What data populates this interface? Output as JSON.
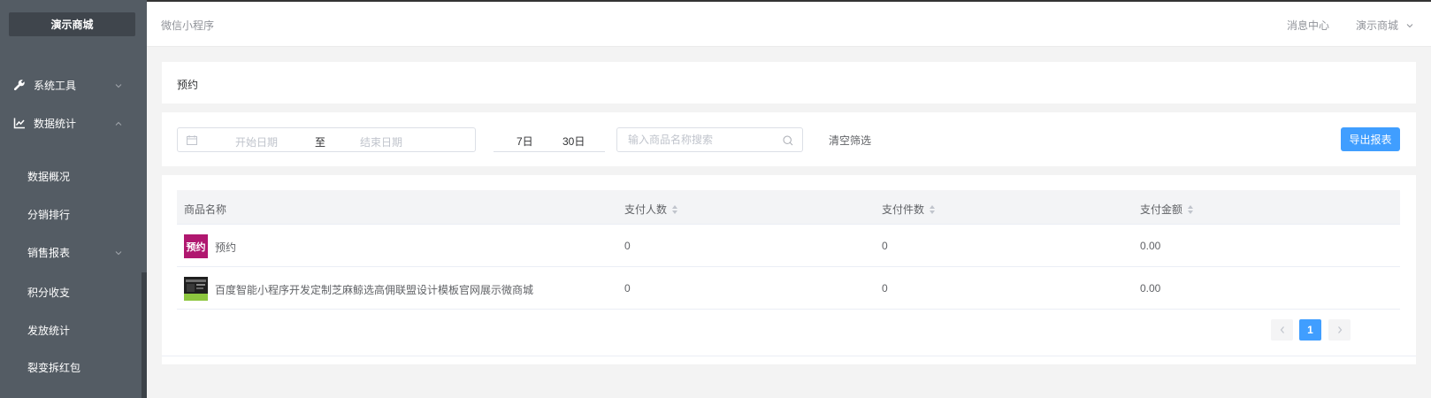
{
  "sidebar": {
    "brand": "演示商城",
    "items": [
      {
        "label": "系统工具",
        "icon": "wrench-icon"
      },
      {
        "label": "数据统计",
        "icon": "line-chart-icon"
      }
    ],
    "sub_items": [
      {
        "label": "数据概况"
      },
      {
        "label": "分销排行"
      },
      {
        "label": "销售报表"
      },
      {
        "label": "积分收支"
      },
      {
        "label": "发放统计"
      },
      {
        "label": "裂变拆红包"
      }
    ]
  },
  "header": {
    "breadcrumb": "微信小程序",
    "message_center": "消息中心",
    "user": "演示商城"
  },
  "page": {
    "title": "预约"
  },
  "filter": {
    "start_placeholder": "开始日期",
    "separator": "至",
    "end_placeholder": "结束日期",
    "quick_7": "7日",
    "quick_30": "30日",
    "search_placeholder": "输入商品名称搜索",
    "clear_label": "清空筛选",
    "export_label": "导出报表"
  },
  "table": {
    "columns": [
      "商品名称",
      "支付人数",
      "支付件数",
      "支付金额"
    ],
    "rows": [
      {
        "name": "预约",
        "thumb_text": "预约",
        "payers": "0",
        "items": "0",
        "amount": "0.00"
      },
      {
        "name": "百度智能小程序开发定制芝麻鲸选高佣联盟设计模板官网展示微商城",
        "thumb_text": "",
        "payers": "0",
        "items": "0",
        "amount": "0.00"
      }
    ]
  },
  "pagination": {
    "current": "1"
  },
  "colors": {
    "sidebar_bg": "#545c64",
    "accent": "#409eff",
    "thumb_magenta": "#b0176f"
  }
}
